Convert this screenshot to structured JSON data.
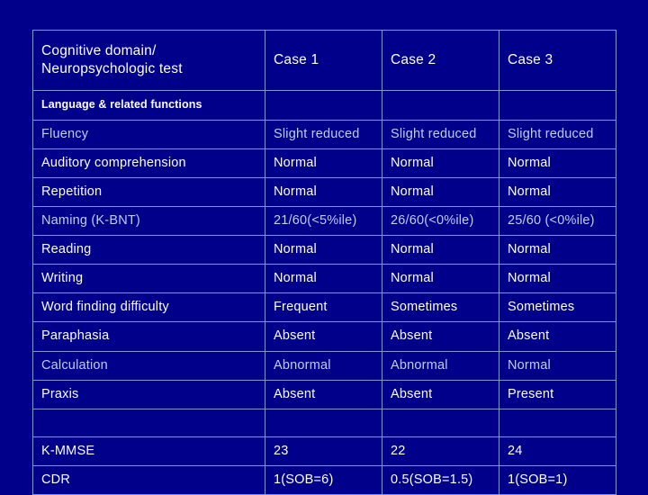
{
  "table": {
    "headers": [
      "Cognitive domain/\nNeuropsychologic test",
      "Case 1",
      "Case 2",
      "Case 3"
    ],
    "header_col0_line1": "Cognitive domain/",
    "header_col0_line2": "Neuropsychologic test",
    "header_col1": "Case 1",
    "header_col2": "Case 2",
    "header_col3": "Case 3",
    "section_label": "Language & related functions",
    "rows": [
      {
        "label": "Fluency",
        "case1": "Slight reduced",
        "case2": "Slight reduced",
        "case3": "Slight reduced",
        "dim": true
      },
      {
        "label": "Auditory comprehension",
        "case1": "Normal",
        "case2": "Normal",
        "case3": "Normal",
        "dim": false
      },
      {
        "label": "Repetition",
        "case1": "Normal",
        "case2": "Normal",
        "case3": "Normal",
        "dim": false
      },
      {
        "label": "Naming (K-BNT)",
        "case1": "21/60(<5%ile)",
        "case2": "26/60(<0%ile)",
        "case3": "25/60 (<0%ile)",
        "dim": true
      },
      {
        "label": "Reading",
        "case1": "Normal",
        "case2": "Normal",
        "case3": "Normal",
        "dim": false
      },
      {
        "label": "Writing",
        "case1": "Normal",
        "case2": "Normal",
        "case3": "Normal",
        "dim": false
      },
      {
        "label": "Word finding difficulty",
        "case1": "Frequent",
        "case2": "Sometimes",
        "case3": "Sometimes",
        "dim": false
      },
      {
        "label": "Paraphasia",
        "case1": "Absent",
        "case2": "Absent",
        "case3": "Absent",
        "dim": false
      },
      {
        "label": "Calculation",
        "case1": "Abnormal",
        "case2": "Abnormal",
        "case3": "Normal",
        "dim": true
      },
      {
        "label": "Praxis",
        "case1": "Absent",
        "case2": "Absent",
        "case3": "Present",
        "dim": false
      },
      {
        "label": "",
        "case1": "",
        "case2": "",
        "case3": "",
        "dim": false,
        "blank": true
      },
      {
        "label": "K-MMSE",
        "case1": "23",
        "case2": "22",
        "case3": "24",
        "dim": false
      },
      {
        "label": "CDR",
        "case1": "1(SOB=6)",
        "case2": "0.5(SOB=1.5)",
        "case3": "1(SOB=1)",
        "dim": false
      }
    ]
  }
}
